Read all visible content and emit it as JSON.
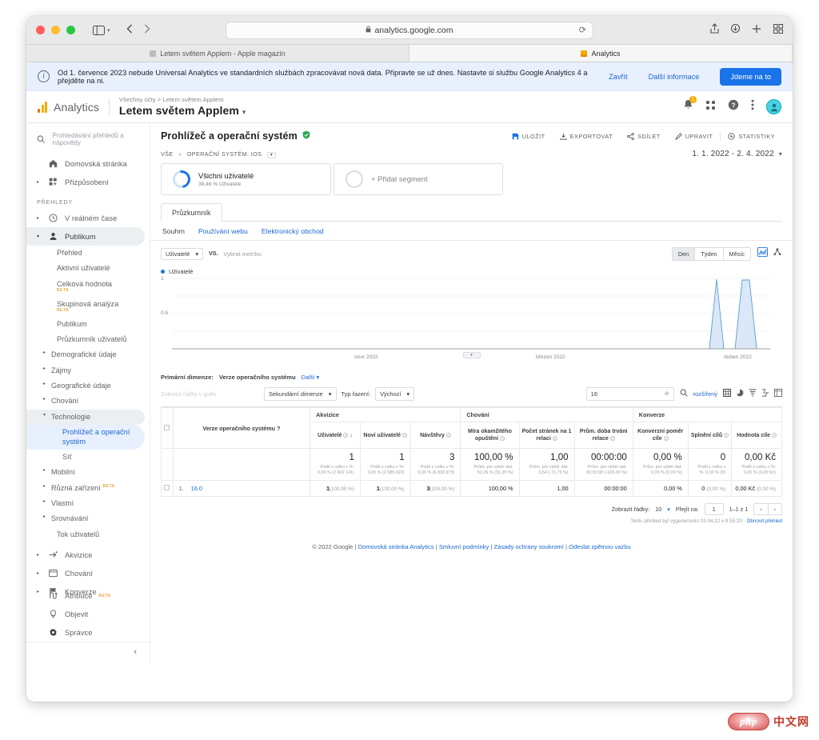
{
  "browser": {
    "address": "analytics.google.com",
    "lock_icon": "lock-icon",
    "reload_icon": "reload-icon",
    "tabs": [
      {
        "title": "Letem světem Applem - Apple magazín",
        "active": false
      },
      {
        "title": "Analytics",
        "active": true
      }
    ]
  },
  "notification": {
    "message": "Od 1. července 2023 nebude Universal Analytics ve standardních službách zpracovávat nová data. Připravte se už dnes. Nastavte si službu Google Analytics 4 a přejděte na ni.",
    "close_label": "Zavřít",
    "more_label": "Další informace",
    "cta_label": "Jdeme na to",
    "accent": "#1a73e8",
    "background": "#e8f0fe"
  },
  "topbar": {
    "product": "Analytics",
    "breadcrumb": "Všechny účty > Letem světem Applem",
    "property": "Letem světem Applem",
    "caret": "▾",
    "notifications_count": "1",
    "icons": [
      "bell-icon",
      "apps-grid-icon",
      "help-icon",
      "more-vert-icon",
      "avatar"
    ]
  },
  "sidebar": {
    "search_placeholder": "Prohledávání přehledů a nápovědy",
    "section_label": "PŘEHLEDY",
    "top_items": [
      {
        "label": "Domovská stránka",
        "icon": "home-icon",
        "expandable": false
      },
      {
        "label": "Přizpůsobení",
        "icon": "customization-icon",
        "expandable": true
      }
    ],
    "groups": [
      {
        "label": "V reálném čase",
        "icon": "clock-icon",
        "expandable": true,
        "expanded": false
      },
      {
        "label": "Publikum",
        "icon": "person-icon",
        "expandable": true,
        "expanded": true
      }
    ],
    "audience_items": [
      {
        "label": "Přehled",
        "beta": false,
        "arrow": false
      },
      {
        "label": "Aktivní uživatelé",
        "beta": false,
        "arrow": false
      },
      {
        "label": "Celková hodnota",
        "beta": true,
        "arrow": false
      },
      {
        "label": "Skupinová analýza",
        "beta": true,
        "arrow": false
      },
      {
        "label": "Publikum",
        "beta": false,
        "arrow": false
      },
      {
        "label": "Průzkumník uživatelů",
        "beta": false,
        "arrow": false
      },
      {
        "label": "Demografické údaje",
        "beta": false,
        "arrow": true
      },
      {
        "label": "Zájmy",
        "beta": false,
        "arrow": true
      },
      {
        "label": "Geografické údaje",
        "beta": false,
        "arrow": true
      },
      {
        "label": "Chování",
        "beta": false,
        "arrow": true
      },
      {
        "label": "Technologie",
        "beta": false,
        "arrow": true,
        "expanded": true
      }
    ],
    "tech_items": [
      {
        "label": "Prohlížeč a operační systém",
        "active": true
      },
      {
        "label": "Síť",
        "active": false
      }
    ],
    "tail_items": [
      {
        "label": "Mobilní",
        "beta": false,
        "arrow": true
      },
      {
        "label": "Různá zařízení",
        "beta": true,
        "arrow": true
      },
      {
        "label": "Vlastní",
        "beta": false,
        "arrow": true
      },
      {
        "label": "Srovnávání",
        "beta": false,
        "arrow": true
      },
      {
        "label": "Tok uživatelů",
        "beta": false,
        "arrow": false
      }
    ],
    "bottom_groups": [
      {
        "label": "Akvizice",
        "icon": "acquisition-icon"
      },
      {
        "label": "Chování",
        "icon": "behavior-icon"
      },
      {
        "label": "Konverze",
        "icon": "flag-icon"
      }
    ],
    "footer_items": [
      {
        "label": "Atribuce",
        "icon": "attribution-icon",
        "beta": true
      },
      {
        "label": "Objevit",
        "icon": "discover-icon",
        "beta": false
      },
      {
        "label": "Správce",
        "icon": "gear-icon",
        "beta": false
      }
    ],
    "collapse_icon": "chevron-left-icon"
  },
  "report": {
    "title": "Prohlížeč a operační systém",
    "verified_icon": "shield-check-icon",
    "actions": [
      {
        "label": "ULOŽIT",
        "icon": "save-icon"
      },
      {
        "label": "EXPORTOVAT",
        "icon": "export-icon"
      },
      {
        "label": "SDÍLET",
        "icon": "share-icon"
      },
      {
        "label": "UPRAVIT",
        "icon": "edit-icon"
      },
      {
        "label": "STATISTIKY",
        "icon": "insights-icon"
      }
    ],
    "segment_scope": "VŠE",
    "segment_scope_sep": "»",
    "segment_filter": "OPERAČNÍ SYSTÉM: IOS",
    "date_range": "1. 1. 2022 - 2. 4. 2022",
    "segments": [
      {
        "name": "Všichni uživatelé",
        "sub": "39,46 % Uživatelé"
      },
      {
        "name": "+ Přidat segment",
        "sub": ""
      }
    ],
    "tab": "Průzkumník",
    "subtabs": [
      {
        "label": "Souhrn",
        "current": true
      },
      {
        "label": "Používání webu",
        "current": false
      },
      {
        "label": "Elektronický obchod",
        "current": false
      }
    ]
  },
  "chart_data": {
    "type": "area",
    "title": "Uživatelé",
    "metric_selector": "Uživatelé",
    "vs_label": "VS.",
    "pick_metric": "Vybrat metriku",
    "granularity": [
      "Den",
      "Týden",
      "Měsíc"
    ],
    "granularity_selected": "Den",
    "legend": [
      "Uživatelé"
    ],
    "legend_position": "top-left",
    "ylabel": "",
    "xlabel": "",
    "ylim": [
      0,
      1
    ],
    "ytick_labels": [
      "1",
      "0.5"
    ],
    "ytick_values": [
      1,
      0.5
    ],
    "xtick_labels": [
      "únor 2022",
      "březen 2022",
      "duben 2022"
    ],
    "grid": true,
    "x": [
      "1. 1. 2022",
      "26. 3. 2022",
      "27. 3. 2022",
      "29. 3. 2022",
      "31. 3. 2022",
      "1. 4. 2022",
      "2. 4. 2022"
    ],
    "values": [
      0,
      0,
      1,
      0,
      0,
      1,
      0
    ],
    "series": [
      {
        "name": "Uživatelé",
        "values": [
          0,
          0,
          1,
          0,
          0,
          1,
          0
        ],
        "color": "#1a73e8"
      }
    ],
    "chart_type_icons": [
      "area-chart-icon",
      "scatter-chart-icon"
    ]
  },
  "table": {
    "primary_dimension_label": "Primární dimenze:",
    "primary_dimension_value": "Verze operačního systému",
    "more_label": "Další",
    "row_filter_placeholder": "Zobrazit řádky v grafu",
    "secondary_dimension": "Sekundární dimenze",
    "sort_type_label": "Typ řazení:",
    "sort_type_value": "Výchozí",
    "search_value": "16",
    "advanced_label": "rozšířený",
    "view_icons": [
      "table-view-icon",
      "pie-view-icon",
      "performance-view-icon",
      "comparison-view-icon",
      "pivot-view-icon"
    ],
    "groups": [
      {
        "label": "",
        "span": 1
      },
      {
        "label": "Akvizice",
        "span": 3
      },
      {
        "label": "Chování",
        "span": 3
      },
      {
        "label": "Konverze",
        "span": 3
      }
    ],
    "dimension_header": "Verze operačního systému",
    "columns": [
      {
        "label": "Uživatelé",
        "sorted": true
      },
      {
        "label": "Noví uživatelé",
        "sorted": false
      },
      {
        "label": "Návštěvy",
        "sorted": false
      },
      {
        "label": "Míra okamžitého opuštění",
        "sorted": false
      },
      {
        "label": "Počet stránek na 1 relaci",
        "sorted": false
      },
      {
        "label": "Prům. doba trvání relace",
        "sorted": false
      },
      {
        "label": "Konverzní poměr cíle",
        "sorted": false
      },
      {
        "label": "Splnění cílů",
        "sorted": false
      },
      {
        "label": "Hodnota cíle",
        "sorted": false
      }
    ],
    "summary": [
      {
        "value": "1",
        "note": "Podíl z celku v %: 0,00 % (2 802 141)"
      },
      {
        "value": "1",
        "note": "Podíl z celku v %: 0,00 % (2 585 822)"
      },
      {
        "value": "3",
        "note": "Podíl z celku v %: 0,00 % (6 833 973)"
      },
      {
        "value": "100,00 %",
        "note": "Prům. pro výběr dat: 52,26 % (91,35 %)"
      },
      {
        "value": "1,00",
        "note": "Prům. pro výběr dat: 3,54 (-71,73 %)"
      },
      {
        "value": "00:00:00",
        "note": "Prům. pro výběr dat: 00:02:08 (-100,00 %)"
      },
      {
        "value": "0,00 %",
        "note": "Prům. pro výběr dat: 0,00 % (0,00 %)"
      },
      {
        "value": "0",
        "note": "Podíl z celku v %: 0,00 % (0)"
      },
      {
        "value": "0,00 Kč",
        "note": "Podíl z celku v %: 0,00 % (0,00 Kč)"
      }
    ],
    "rows": [
      {
        "index": "1.",
        "name": "16.0",
        "cells": [
          {
            "main": "1",
            "pct": "(100,00 %)"
          },
          {
            "main": "1",
            "pct": "(100,00 %)"
          },
          {
            "main": "3",
            "pct": "(100,00 %)"
          },
          {
            "main": "100,00 %",
            "pct": ""
          },
          {
            "main": "1,00",
            "pct": ""
          },
          {
            "main": "00:00:00",
            "pct": ""
          },
          {
            "main": "0,00 %",
            "pct": ""
          },
          {
            "main": "0",
            "pct": "(0,00 %)"
          },
          {
            "main": "0,00 Kč",
            "pct": "(0,00 %)"
          }
        ]
      }
    ],
    "footer": {
      "rows_label": "Zobrazit řádky:",
      "rows_value": "10",
      "goto_label": "Přejít na:",
      "goto_value": "1",
      "range": "1–1 z 1",
      "prev": "‹",
      "next": "›"
    },
    "generated_note": "Tento přehled byl vygenerován 03.04.22 v 8:55:20 ·",
    "refresh_link": "Obnovit přehled"
  },
  "page_footer": {
    "copyright": "© 2022 Google",
    "links": [
      "Domovská stránka Analytics",
      "Smluvní podmínky",
      "Zásady ochrany soukromí",
      "Odeslat zpětnou vazbu"
    ]
  },
  "watermark": {
    "php": "php",
    "cn": "中文网"
  }
}
